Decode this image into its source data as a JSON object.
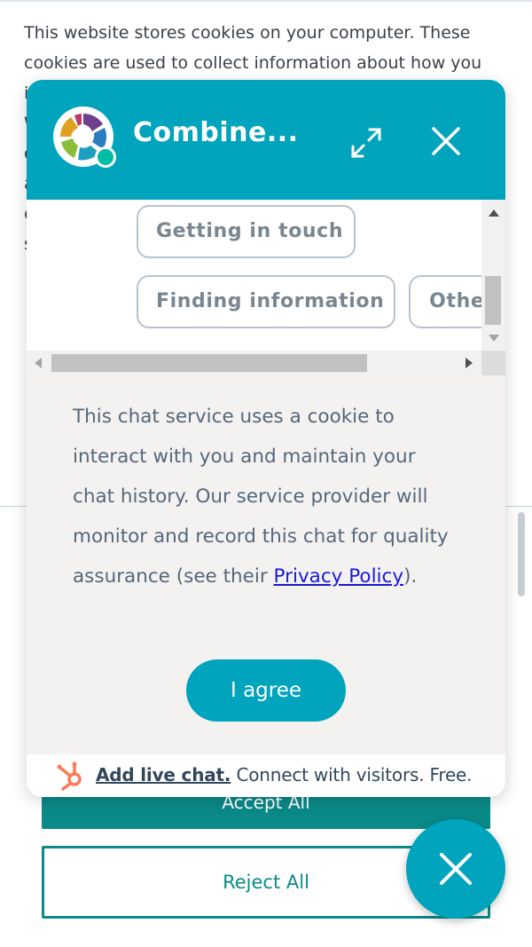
{
  "cookie_banner": {
    "text": "This website stores cookies on your computer. These cookies are used to collect information about how you interact with our website and allow us to remember you. We use this information in order to improve and customize your browsing experience and for analytics and metrics about our visitors both on this website and other media. To find out more about the cookies we use, see our Privacy Policy.",
    "accept_label": "Accept All",
    "reject_label": "Reject All"
  },
  "chat": {
    "title": "Combine...",
    "options": [
      "Getting in touch",
      "Finding information",
      "Other"
    ],
    "consent": {
      "text_before": "This chat service uses a cookie to interact with you and maintain your chat history. Our service provider will monitor and record this chat for quality assurance (see their ",
      "privacy_link": "Privacy Policy",
      "text_after": ")."
    },
    "agree_label": "I agree",
    "footer": {
      "link": "Add live chat.",
      "text": " Connect with visitors. Free."
    }
  },
  "colors": {
    "chat_accent": "#00a4bd",
    "banner_button": "#0a8a89",
    "link": "#1a1ad8"
  },
  "icons": {
    "logo": "combine-logo-icon",
    "expand": "expand-icon",
    "close": "close-icon",
    "hubspot": "hubspot-icon",
    "launcher": "close-icon"
  }
}
